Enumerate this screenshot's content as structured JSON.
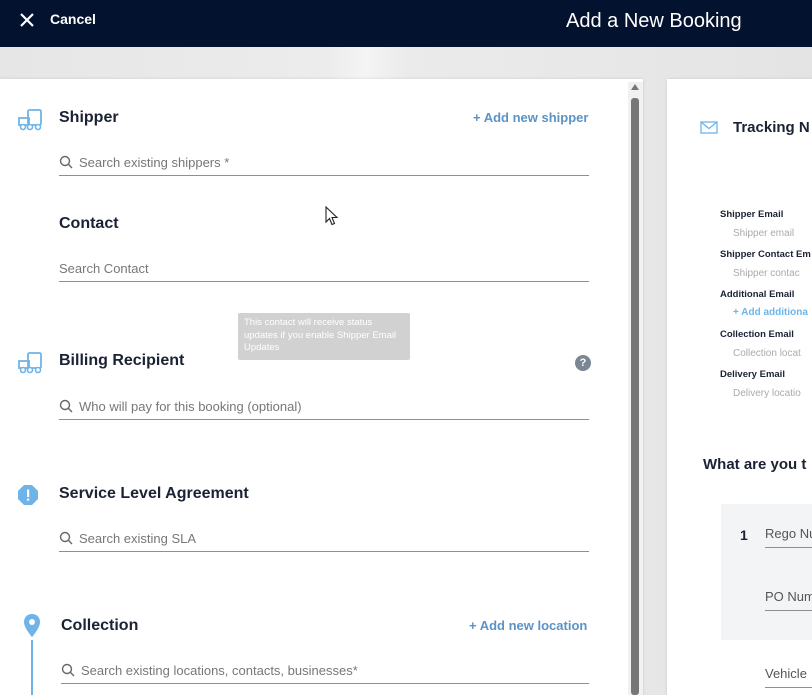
{
  "topbar": {
    "cancel_label": "Cancel",
    "title": "Add a New Booking"
  },
  "shipper": {
    "title": "Shipper",
    "add_link": "+ Add new shipper",
    "placeholder": "Search existing shippers *"
  },
  "contact": {
    "title": "Contact",
    "placeholder": "Search Contact",
    "tooltip": "This contact will receive status updates if you enable Shipper Email Updates"
  },
  "billing": {
    "title": "Billing Recipient",
    "placeholder": "Who will pay for this booking (optional)",
    "help": "?"
  },
  "sla": {
    "title": "Service Level Agreement",
    "placeholder": "Search existing SLA"
  },
  "collection": {
    "title": "Collection",
    "add_link": "+ Add new location",
    "placeholder": "Search existing locations, contacts, businesses*"
  },
  "tracking": {
    "title": "Tracking N",
    "shipper_email_label": "Shipper Email",
    "shipper_email_placeholder": "Shipper email",
    "shipper_contact_label": "Shipper Contact Em",
    "shipper_contact_placeholder": "Shipper contac",
    "additional_label": "Additional Email",
    "additional_add": "+ Add additiona",
    "collection_label": "Collection Email",
    "collection_placeholder": "Collection locat",
    "delivery_label": "Delivery Email",
    "delivery_placeholder": "Delivery locatio"
  },
  "items": {
    "question": "What are you t",
    "item_number": "1",
    "rego": "Rego Nu",
    "po": "PO Num",
    "vehicle": "Vehicle"
  },
  "colors": {
    "topbar": "#03122e",
    "accent": "#5b93c6",
    "icon_blue": "#6fb4e8"
  }
}
